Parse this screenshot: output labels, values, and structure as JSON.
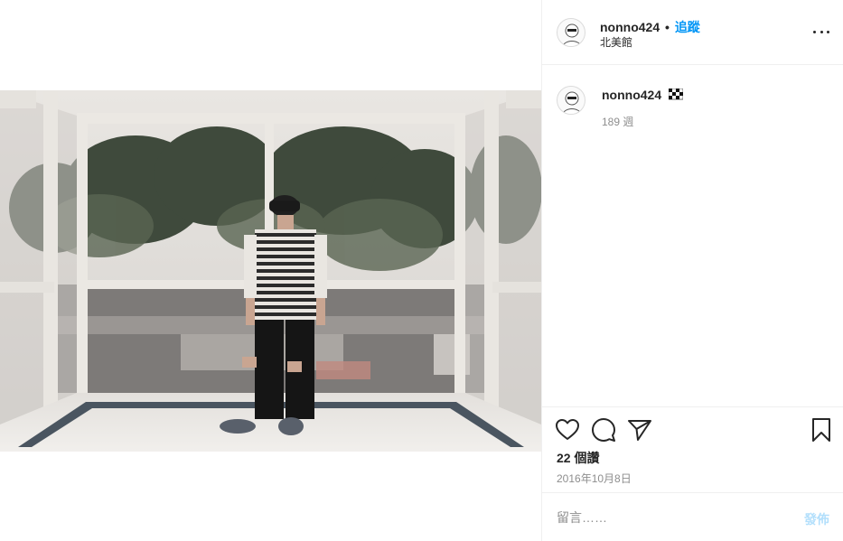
{
  "post": {
    "media_alt": "",
    "header": {
      "username": "nonno424",
      "separator": "•",
      "follow_label": "追蹤",
      "location": "北美館"
    },
    "caption": {
      "username": "nonno424",
      "flag_icon": "checkered-flag-icon",
      "time_ago": "189 週"
    },
    "actions": {
      "like_icon": "heart-icon",
      "comment_icon": "comment-bubble-icon",
      "share_icon": "paper-plane-icon",
      "save_icon": "bookmark-icon"
    },
    "likes_text": "22 個讚",
    "date_text": "2016年10月8日",
    "comment_box": {
      "placeholder": "留言……",
      "post_label": "發佈"
    },
    "colors": {
      "link_blue": "#0095f6",
      "post_disabled": "#b2dffc",
      "secondary_text": "#8e8e8e",
      "divider": "#efefef"
    }
  }
}
